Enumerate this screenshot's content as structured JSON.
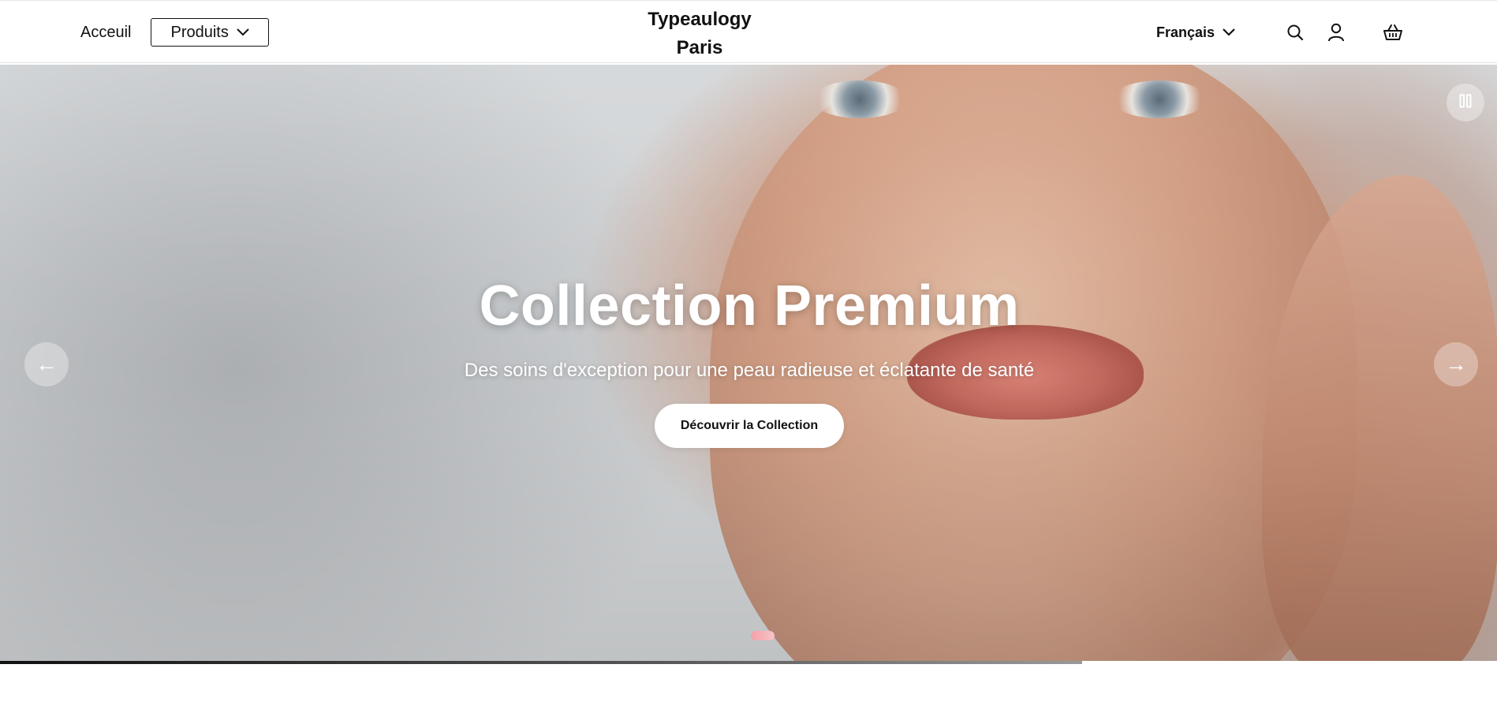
{
  "header": {
    "nav": {
      "home_label": "Acceuil",
      "products_label": "Produits"
    },
    "brand": {
      "line1": "Typeaulogy",
      "line2": "Paris"
    },
    "language_label": "Français",
    "icons": [
      "search-icon",
      "account-icon",
      "basket-icon",
      "chevron-down-icon"
    ]
  },
  "hero": {
    "title": "Collection Premium",
    "subtitle": "Des soins d'exception pour une peau radieuse et éclatante de santé",
    "cta_label": "Découvrir la Collection",
    "prev_glyph": "←",
    "next_glyph": "→",
    "slide_count": 1,
    "active_slide": 1,
    "autoplay_progress": 0.723,
    "controls": [
      "pause-icon"
    ],
    "colors": {
      "cta_background": "#ffffff",
      "dot_active": "#f3a0a8",
      "progress_bar": "#111111"
    }
  }
}
